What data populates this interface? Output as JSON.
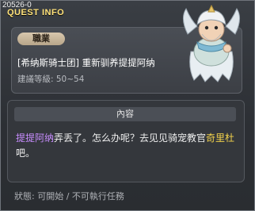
{
  "window": {
    "quest_id": "20526-0",
    "title": "QUEST INFO"
  },
  "quest": {
    "tag": "職業",
    "name": "[希纳斯骑士团] 重新驯养提提阿纳",
    "level": "建議等級: 50~54"
  },
  "content": {
    "header": "內容",
    "parts": [
      {
        "text": "提提阿纳",
        "color": "purple"
      },
      {
        "text": "弄丢了。怎么办呢？去见见骑宠教官",
        "color": "white"
      },
      {
        "text": "奇里杜",
        "color": "yellow"
      },
      {
        "text": "吧。",
        "color": "white"
      }
    ]
  },
  "status": "狀態: 可開始 / 不可執行任務",
  "colors": {
    "title": "#ffe27a",
    "npc_name": "#c88dff",
    "npc2_name": "#f4d34b"
  }
}
